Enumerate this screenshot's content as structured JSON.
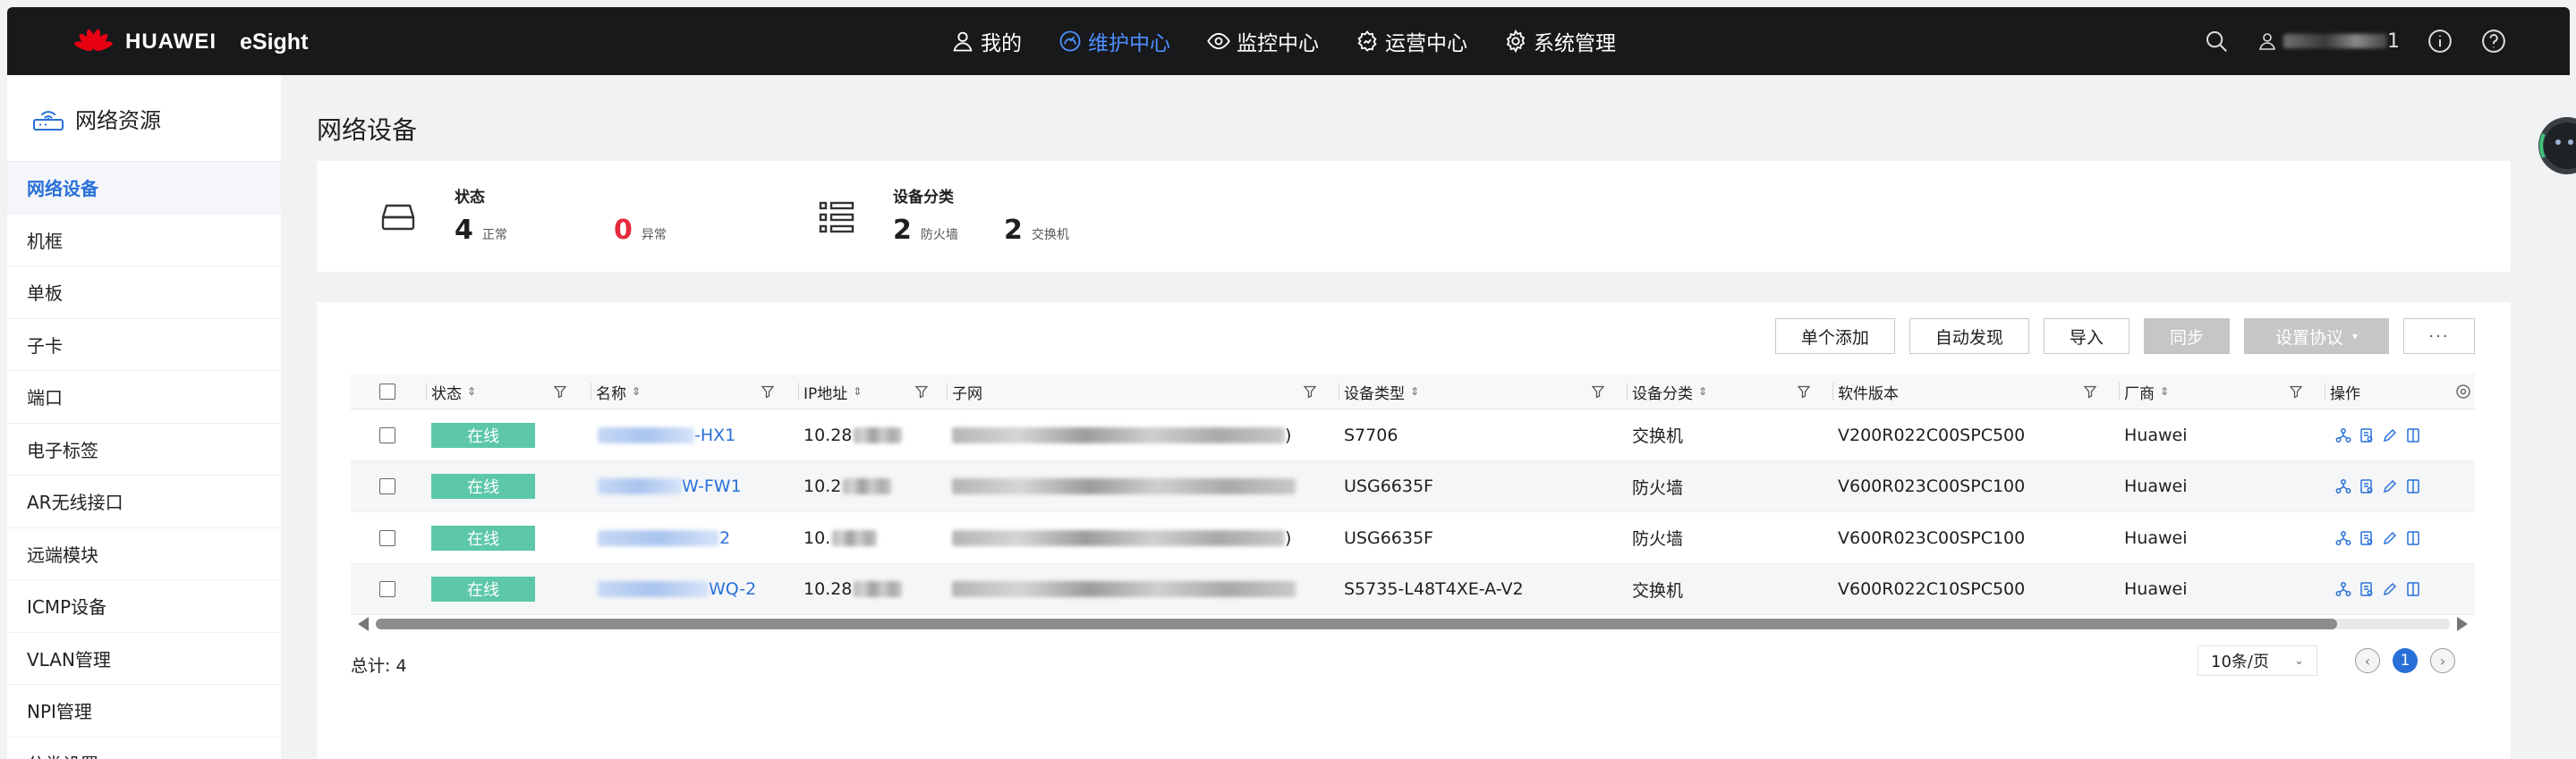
{
  "brand": {
    "company": "HUAWEI",
    "product": "eSight"
  },
  "topnav": [
    {
      "label": "我的",
      "icon": "user-icon",
      "active": false
    },
    {
      "label": "维护中心",
      "icon": "gauge-icon",
      "active": true
    },
    {
      "label": "监控中心",
      "icon": "eye-icon",
      "active": false
    },
    {
      "label": "运营中心",
      "icon": "gear-chart-icon",
      "active": false
    },
    {
      "label": "系统管理",
      "icon": "settings-icon",
      "active": false
    }
  ],
  "topright": {
    "user_suffix": "1"
  },
  "sidebar": {
    "title": "网络资源",
    "items": [
      "网络设备",
      "机框",
      "单板",
      "子卡",
      "端口",
      "电子标签",
      "AR无线接口",
      "远端模块",
      "ICMP设备",
      "VLAN管理",
      "NPI管理",
      "分类设置"
    ]
  },
  "page": {
    "title": "网络设备"
  },
  "stats": {
    "status": {
      "title": "状态",
      "normal_count": "4",
      "normal_label": "正常",
      "abnormal_count": "0",
      "abnormal_label": "异常"
    },
    "category": {
      "title": "设备分类",
      "firewall_count": "2",
      "firewall_label": "防火墙",
      "switch_count": "2",
      "switch_label": "交换机"
    }
  },
  "toolbar": {
    "add_single": "单个添加",
    "auto_discover": "自动发现",
    "import": "导入",
    "sync": "同步",
    "set_protocol": "设置协议",
    "more": "···"
  },
  "table": {
    "columns": {
      "status": "状态",
      "name": "名称",
      "ip": "IP地址",
      "subnet": "子网",
      "device_type": "设备类型",
      "category": "设备分类",
      "software": "软件版本",
      "vendor": "厂商",
      "ops": "操作"
    },
    "rows": [
      {
        "status": "在线",
        "name": "-HX1",
        "ip": "10.28",
        "subnet": ")",
        "device_type": "S7706",
        "category": "交换机",
        "software": "V200R022C00SPC500",
        "vendor": "Huawei"
      },
      {
        "status": "在线",
        "name": "W-FW1",
        "ip": "10.2",
        "subnet": "",
        "device_type": "USG6635F",
        "category": "防火墙",
        "software": "V600R023C00SPC100",
        "vendor": "Huawei"
      },
      {
        "status": "在线",
        "name": "2",
        "ip": "10.",
        "subnet": ")",
        "device_type": "USG6635F",
        "category": "防火墙",
        "software": "V600R023C00SPC100",
        "vendor": "Huawei"
      },
      {
        "status": "在线",
        "name": "WQ-2",
        "ip": "10.28",
        "subnet": "",
        "device_type": "S5735-L48T4XE-A-V2",
        "category": "交换机",
        "software": "V600R022C10SPC500",
        "vendor": "Huawei"
      }
    ]
  },
  "footer": {
    "total": "总计: 4",
    "page_size": "10条/页",
    "current_page": "1"
  },
  "colors": {
    "topbar": "#18191b",
    "accent": "#2870d8",
    "online": "#5dc8a8",
    "abnormal": "#e52a3b",
    "logo": "#e60012"
  }
}
